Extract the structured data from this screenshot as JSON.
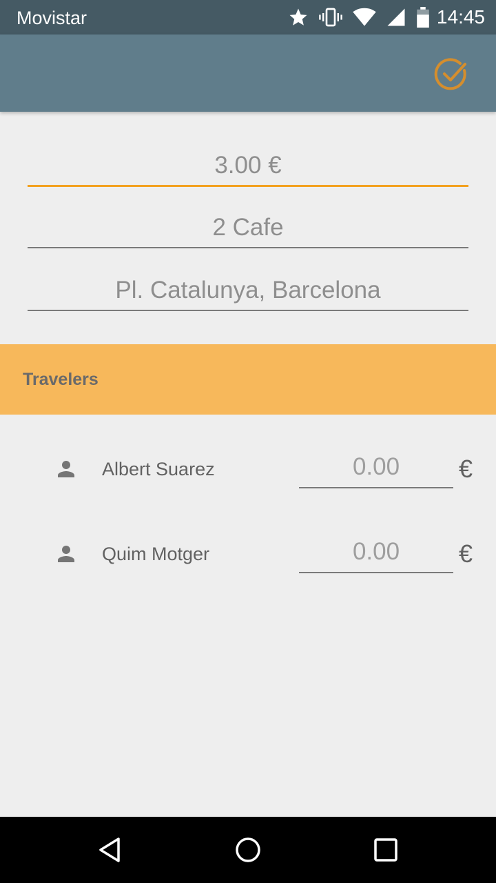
{
  "status_bar": {
    "carrier": "Movistar",
    "time": "14:45",
    "icons": [
      "star-icon",
      "vibrate-icon",
      "wifi-icon",
      "signal-icon",
      "battery-icon"
    ]
  },
  "app_bar": {
    "action_icon": "check-circle-icon",
    "accent_color": "#f3a11f",
    "background_color": "#607d8b"
  },
  "form": {
    "amount": "3.00 €",
    "description": "2 Cafe",
    "location": "Pl. Catalunya, Barcelona"
  },
  "travelers_section": {
    "title": "Travelers",
    "header_color": "#f7b85b",
    "items": [
      {
        "name": "Albert Suarez",
        "amount": "0.00",
        "currency": "€"
      },
      {
        "name": "Quim Motger",
        "amount": "0.00",
        "currency": "€"
      }
    ]
  },
  "nav_bar": {
    "icons": [
      "back-icon",
      "home-icon",
      "recents-icon"
    ]
  }
}
